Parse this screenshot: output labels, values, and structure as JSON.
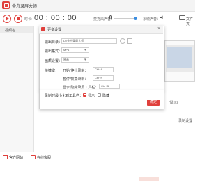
{
  "app": {
    "title": "金舟录屏大师"
  },
  "toolbar": {
    "duration_label": "时长:",
    "timer": "00 : 00 : 00",
    "mic_label": "麦克风声音：",
    "system_audio_label": "系统声音：",
    "folder_label": "文件夹"
  },
  "sidebar": {
    "header": "视频名"
  },
  "background": {
    "label_1": "(鼠标)",
    "label_2": "录制设置"
  },
  "footer": {
    "official_site": "官方网站",
    "contact": "在线客服"
  },
  "dialog": {
    "title": "更多设置",
    "output_dir_label": "输出目录：",
    "output_dir_value": "D:\\金舟录屏大师",
    "output_format_label": "输出格式：",
    "output_format_value": "MP4",
    "quality_label": "画质设置：",
    "quality_value": "原画",
    "hotkey_label": "快捷键：",
    "hotkey1_label": "开始/停止录制：",
    "hotkey1_value": "Ctrl+A",
    "hotkey2_label": "暂停/恢复录制：",
    "hotkey2_value": "Ctrl+F",
    "hotkey3_label": "显示/隐藏录屏工具栏：",
    "hotkey3_value": "Ctrl+B",
    "minimize_label": "录制时最小化到工具栏：",
    "option_show": "显示",
    "option_hide": "隐藏",
    "confirm_label": "确定"
  }
}
